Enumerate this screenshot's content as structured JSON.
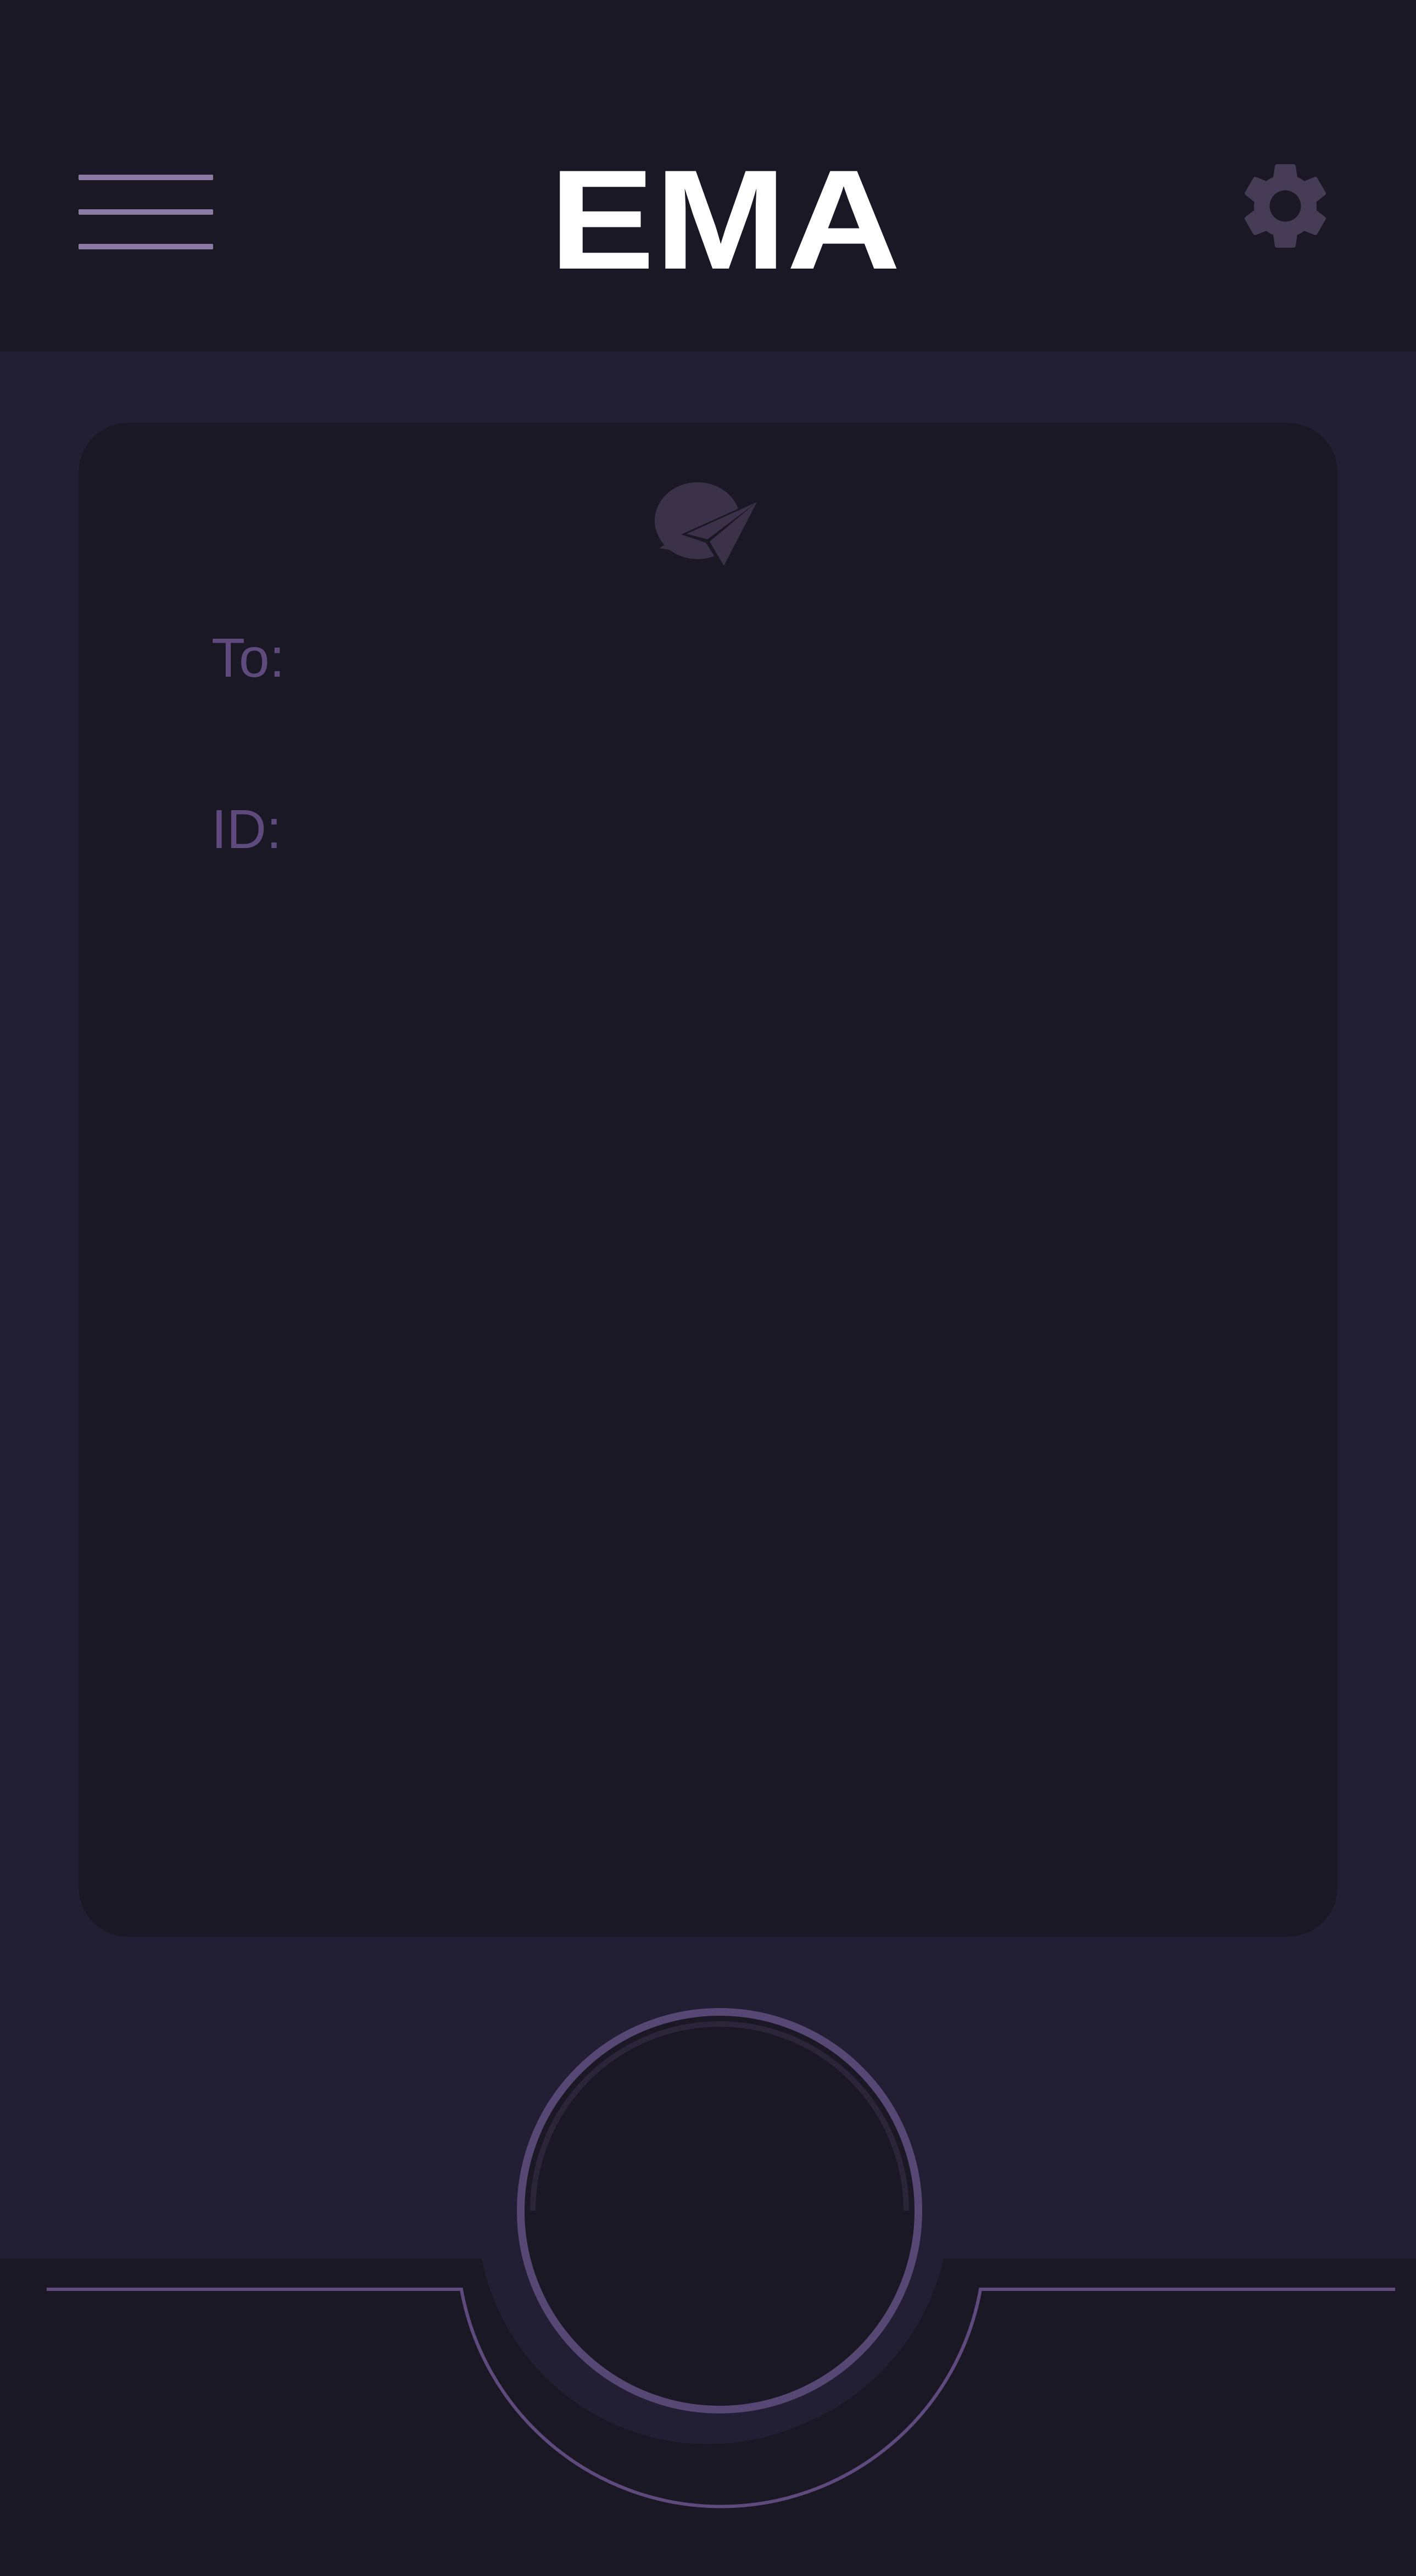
{
  "header": {
    "logo_text": "EMA",
    "menu_icon": "hamburger-menu-icon",
    "settings_icon": "gear-icon"
  },
  "compose": {
    "icon": "send-message-icon",
    "to_label": "To:",
    "to_value": "",
    "id_label": "ID:",
    "id_value": ""
  },
  "action": {
    "button_icon": "circle-record-button"
  },
  "colors": {
    "background": "#221e34",
    "surface": "#1b1825",
    "accent": "#5e4a7d",
    "accent_light": "#8b7aa3",
    "logo": "#ffffff"
  }
}
